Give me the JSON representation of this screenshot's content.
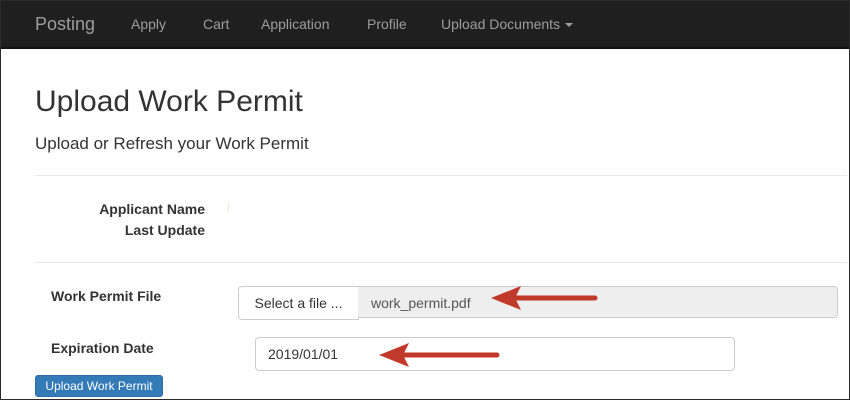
{
  "navbar": {
    "brand": "Posting",
    "items": [
      {
        "label": "Apply"
      },
      {
        "label": "Cart"
      },
      {
        "label": "Application"
      },
      {
        "label": "Profile"
      },
      {
        "label": "Upload Documents"
      }
    ]
  },
  "header": {
    "title": "Upload Work Permit",
    "subtitle": "Upload or Refresh your Work Permit"
  },
  "info": {
    "applicant_name_label": "Applicant Name",
    "last_update_label": "Last Update"
  },
  "form": {
    "file_label": "Work Permit File",
    "select_file_label": "Select a file ...",
    "file_name": "work_permit.pdf",
    "expiration_label": "Expiration Date",
    "expiration_value": "2019/01/01",
    "upload_button_label": "Upload Work Permit"
  },
  "colors": {
    "navbar_bg": "#1f1f1f",
    "primary_button": "#337ab7",
    "annotation_arrow": "#c0392b"
  },
  "icons": {
    "dropdown": "caret-down-icon",
    "annotation": "red-arrow-icon"
  }
}
